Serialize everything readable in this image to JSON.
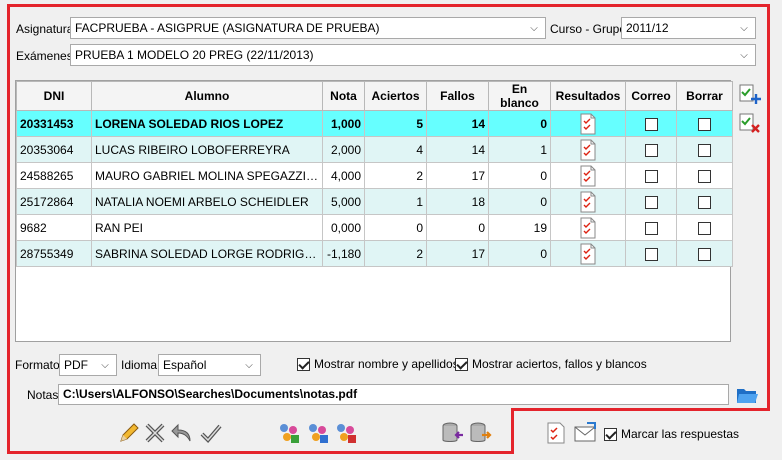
{
  "header": {
    "asignatura_label": "Asignatura",
    "asignatura_value": "FACPRUEBA - ASIGPRUE (ASIGNATURA DE PRUEBA)",
    "curso_label": "Curso - Grupo",
    "curso_value": "2011/12",
    "examenes_label": "Exámenes",
    "examenes_value": "PRUEBA 1 MODELO 20 PREG (22/11/2013)"
  },
  "table": {
    "columns": [
      "DNI",
      "Alumno",
      "Nota",
      "Aciertos",
      "Fallos",
      "En blanco",
      "Resultados",
      "Correo",
      "Borrar"
    ],
    "rows": [
      {
        "dni": "20331453",
        "alumno": "LORENA SOLEDAD RIOS LOPEZ",
        "nota": "1,000",
        "aciertos": "5",
        "fallos": "14",
        "blanco": "0"
      },
      {
        "dni": "20353064",
        "alumno": "LUCAS RIBEIRO LOBOFERREYRA",
        "nota": "2,000",
        "aciertos": "4",
        "fallos": "14",
        "blanco": "1"
      },
      {
        "dni": "24588265",
        "alumno": "MAURO GABRIEL MOLINA SPEGAZZINI...",
        "nota": "4,000",
        "aciertos": "2",
        "fallos": "17",
        "blanco": "0"
      },
      {
        "dni": "25172864",
        "alumno": "NATALIA NOEMI ARBELO SCHEIDLER",
        "nota": "5,000",
        "aciertos": "1",
        "fallos": "18",
        "blanco": "0"
      },
      {
        "dni": "9682",
        "alumno": "RAN PEI",
        "nota": "0,000",
        "aciertos": "0",
        "fallos": "0",
        "blanco": "19"
      },
      {
        "dni": "28755349",
        "alumno": "SABRINA SOLEDAD LORGE RODRIGU...",
        "nota": "-1,180",
        "aciertos": "2",
        "fallos": "17",
        "blanco": "0"
      }
    ]
  },
  "options": {
    "formato_label": "Formato",
    "formato_value": "PDF",
    "idioma_label": "Idioma",
    "idioma_value": "Español",
    "mostrar_nombre_label": "Mostrar nombre y apellidos",
    "mostrar_aciertos_label": "Mostrar aciertos, fallos y blancos",
    "notas_label": "Notas",
    "notas_path": "C:\\Users\\ALFONSO\\Searches\\Documents\\notas.pdf"
  },
  "footer": {
    "marcar_label": "Marcar las respuestas"
  },
  "colors": {
    "selected_row": "#66ffff",
    "alt_row": "#e0f5f5",
    "highlight_border": "#e4242c"
  }
}
